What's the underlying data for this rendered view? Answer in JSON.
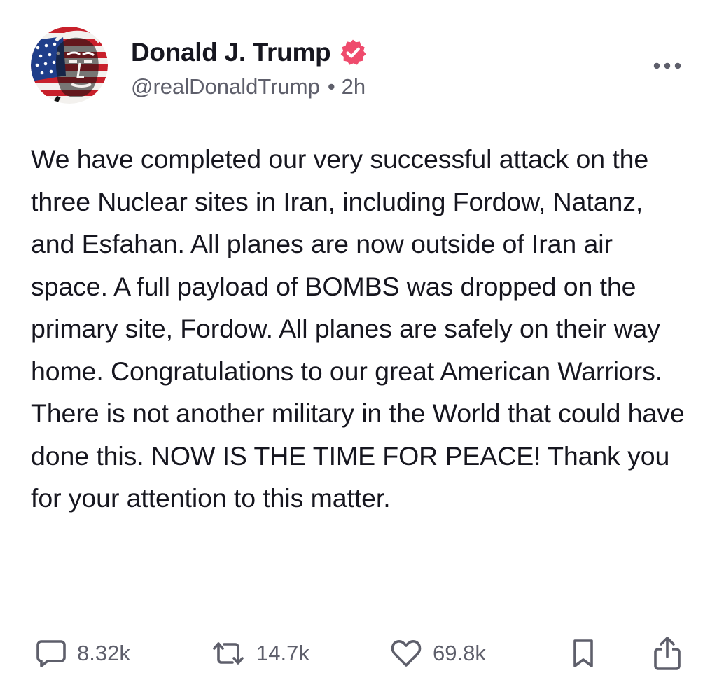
{
  "post": {
    "author": {
      "display_name": "Donald J. Trump",
      "verified": true,
      "handle": "@realDonaldTrump",
      "separator": "•",
      "time_ago": "2h"
    },
    "text": "We have completed our very successful attack on the three Nuclear sites in Iran, including Fordow, Natanz, and Esfahan. All planes are now outside of Iran air space. A full payload of BOMBS was dropped on the primary site, Fordow. All planes are safely on their way home. Congratulations to our great American Warriors. There is not another military in the World that could have done this. NOW IS THE TIME FOR PEACE! Thank you for your attention to this matter.",
    "actions": {
      "replies": {
        "icon": "reply-icon",
        "count": "8.32k"
      },
      "reposts": {
        "icon": "repost-icon",
        "count": "14.7k"
      },
      "likes": {
        "icon": "heart-icon",
        "count": "69.8k"
      },
      "bookmark": {
        "icon": "bookmark-icon"
      },
      "share": {
        "icon": "share-icon"
      }
    }
  },
  "colors": {
    "text": "#16161f",
    "muted": "#5e5f6b",
    "verified_badge": "#ef4b6d"
  }
}
